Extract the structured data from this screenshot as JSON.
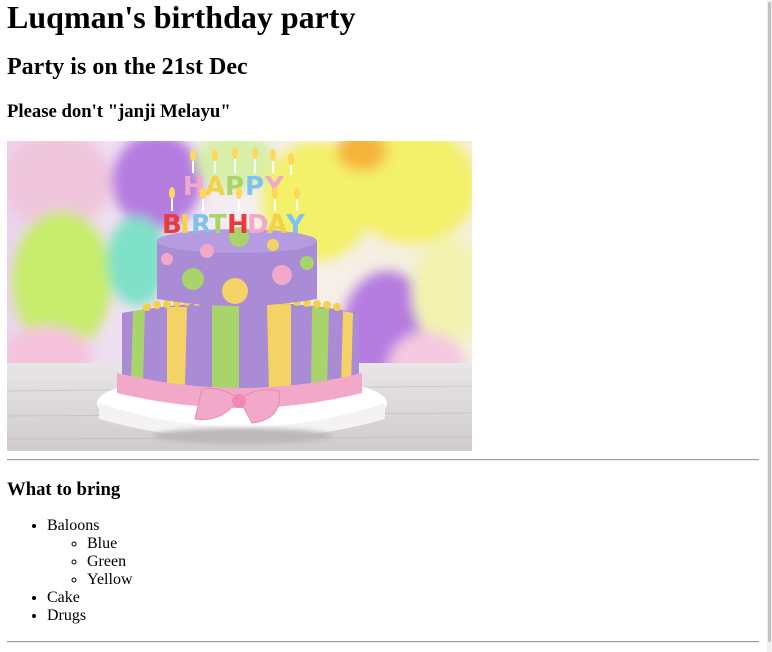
{
  "title": "Luqman's birthday party",
  "subtitle": "Party is on the 21st Dec",
  "note": "Please don't \"janji Melayu\"",
  "cake_image": {
    "candle_text_top": "HAPPY",
    "candle_text_bottom": "BIRTHDAY",
    "colors": {
      "balloon_purple": "#b57be0",
      "balloon_yellow": "#f3f06a",
      "balloon_green": "#c7ec6c",
      "cake_purple": "#a98bd6",
      "ribbon_pink": "#f2a9c9",
      "stripe_yellow": "#f5d265",
      "stripe_green": "#a9d36b"
    }
  },
  "bring_heading": "What to bring",
  "items": [
    {
      "label": "Baloons",
      "sub": [
        "Blue",
        "Green",
        "Yellow"
      ]
    },
    {
      "label": "Cake"
    },
    {
      "label": "Drugs"
    }
  ]
}
